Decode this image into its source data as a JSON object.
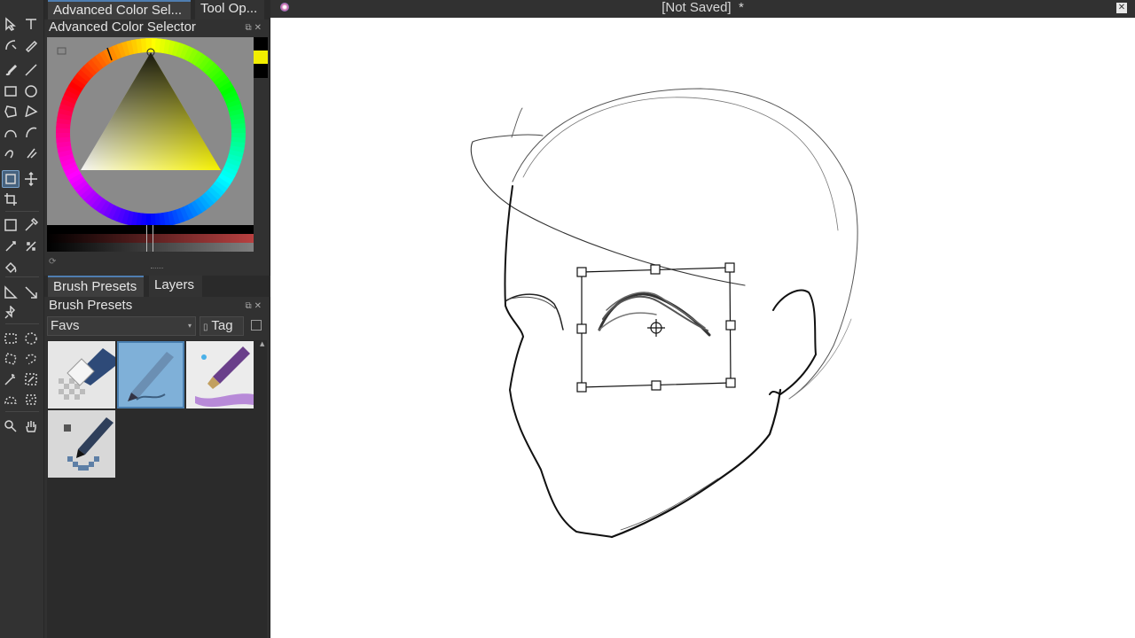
{
  "dock": {
    "tabs": [
      "Advanced Color Sel...",
      "Tool Op..."
    ],
    "color_selector_title": "Advanced Color Selector",
    "foreground_color": "#f2ee00",
    "background_color": "#000000",
    "bottom_tabs": [
      "Brush Presets",
      "Layers"
    ],
    "brush_presets_title": "Brush Presets",
    "preset_filter": "Favs",
    "tag_label": "Tag",
    "presets": [
      "eraser-preset",
      "pencil-preset",
      "watercolor-preset",
      "pixel-pen-preset"
    ],
    "selected_preset_index": 1
  },
  "document": {
    "title": "[Not Saved]",
    "modified_marker": "*"
  },
  "toolbox": {
    "active_tool": "transform-tool"
  },
  "colors": {
    "accent": "#4f7db0",
    "panel": "#313131",
    "canvas": "#ffffff"
  }
}
